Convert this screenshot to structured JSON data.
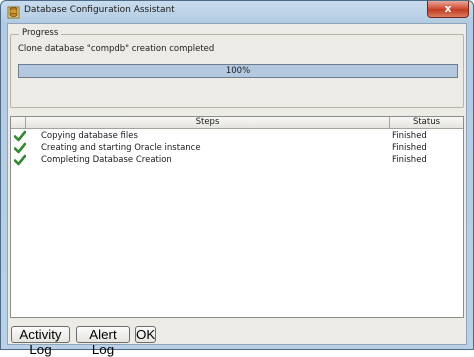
{
  "window": {
    "title": "Database Configuration Assistant",
    "close_label": "x"
  },
  "progress": {
    "group_label": "Progress",
    "message": "Clone database \"compdb\" creation completed",
    "percent_label": "100%",
    "percent_value": 1.0
  },
  "table": {
    "headers": {
      "steps": "Steps",
      "status": "Status"
    },
    "rows": [
      {
        "step": "Copying database files",
        "status": "Finished",
        "icon": "check-icon"
      },
      {
        "step": "Creating and starting Oracle instance",
        "status": "Finished",
        "icon": "check-icon"
      },
      {
        "step": "Completing Database Creation",
        "status": "Finished",
        "icon": "check-icon"
      }
    ]
  },
  "buttons": {
    "activity_log": "Activity Log",
    "alert_log": "Alert Log",
    "ok": "OK"
  },
  "colors": {
    "progress_fill": "#b4c8e0",
    "check": "#2e8b2e"
  }
}
